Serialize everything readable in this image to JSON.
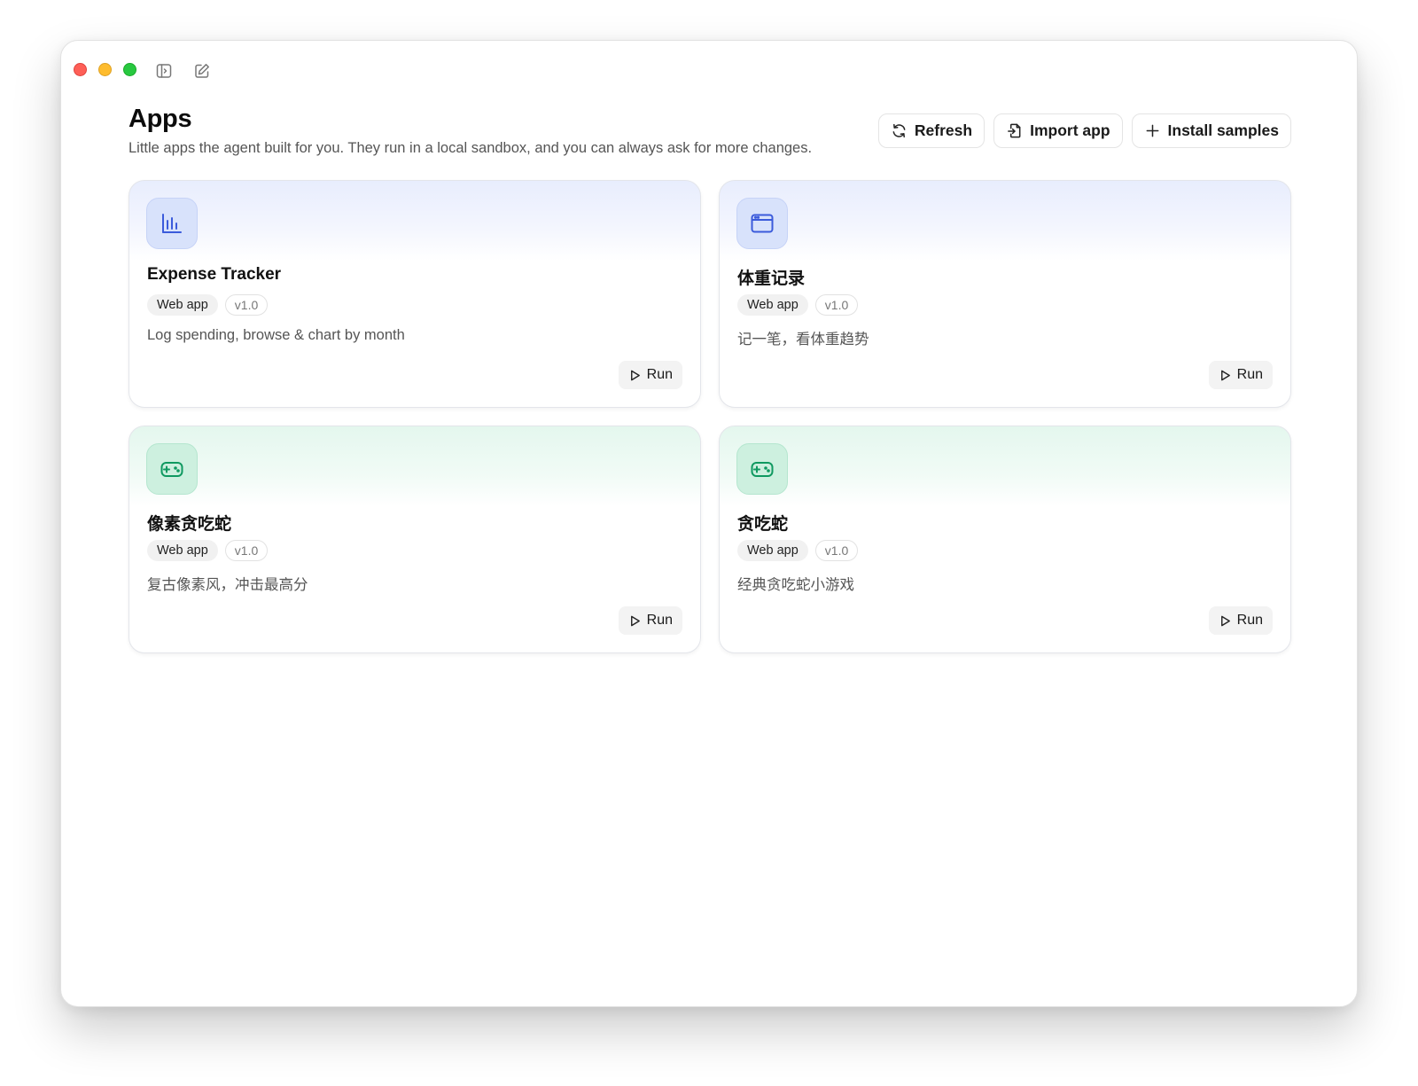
{
  "window": {
    "controls": [
      "close",
      "minimize",
      "zoom"
    ],
    "toolbar_icons": [
      "sidebar-toggle-icon",
      "compose-icon"
    ]
  },
  "header": {
    "title": "Apps",
    "subtitle": "Little apps the agent built for you. They run in a local sandbox, and you can always ask for more changes.",
    "actions": {
      "refresh": {
        "label": "Refresh",
        "icon": "refresh-icon"
      },
      "import": {
        "label": "Import app",
        "icon": "file-import-icon"
      },
      "install": {
        "label": "Install samples",
        "icon": "plus-icon"
      }
    }
  },
  "apps": [
    {
      "name": "Expense Tracker",
      "type": "Web app",
      "version": "v1.0",
      "description": "Log spending, browse & chart by month",
      "icon": "bar-chart-icon",
      "theme": "blue",
      "theme_color": "#3b5bdb",
      "run_label": "Run"
    },
    {
      "name": "体重记录",
      "type": "Web app",
      "version": "v1.0",
      "description": "记一笔，看体重趋势",
      "icon": "browser-window-icon",
      "theme": "blue",
      "theme_color": "#3b5bdb",
      "run_label": "Run"
    },
    {
      "name": "像素贪吃蛇",
      "type": "Web app",
      "version": "v1.0",
      "description": "复古像素风，冲击最高分",
      "icon": "gamepad-icon",
      "theme": "green",
      "theme_color": "#0f9960",
      "run_label": "Run"
    },
    {
      "name": "贪吃蛇",
      "type": "Web app",
      "version": "v1.0",
      "description": "经典贪吃蛇小游戏",
      "icon": "gamepad-icon",
      "theme": "green",
      "theme_color": "#0f9960",
      "run_label": "Run"
    }
  ]
}
